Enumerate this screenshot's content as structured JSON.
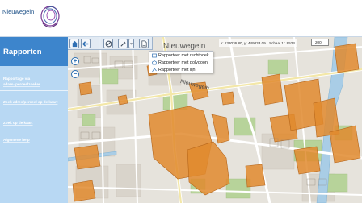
{
  "header": {
    "logo_text": "Nieuwegein"
  },
  "sidebar": {
    "title": "Rapporten",
    "links": [
      "Rapportage via adres-/perceelzoeker",
      "Zoek adres/perceel op de kaart",
      "Zoek op de kaart",
      "Algemene help"
    ]
  },
  "map": {
    "coordinates": "x: 133036.80, y: 449833.09",
    "scale_label": "Schaal 1 : 9524",
    "scale_value": "200",
    "street_label_top": "Nieuwegein",
    "street_label_mid": "Nieuwegein",
    "menu_items": [
      "Rapporteer met rechthoek",
      "Rapporteer met polygoon",
      "Rapporteer met lijn"
    ],
    "zoom_in": "+",
    "zoom_out": "−",
    "colors": {
      "parcel": "#e08a2e",
      "parcel_stroke": "#b5651a",
      "sidebar_title": "#3d85cc",
      "sidebar_bg": "#b8d8f3"
    }
  },
  "icons": [
    "home-icon",
    "back-icon",
    "no-entry-icon",
    "select-icon",
    "dropdown-arrow-icon",
    "report-icon",
    "rectangle-icon",
    "polygon-icon",
    "line-icon"
  ]
}
